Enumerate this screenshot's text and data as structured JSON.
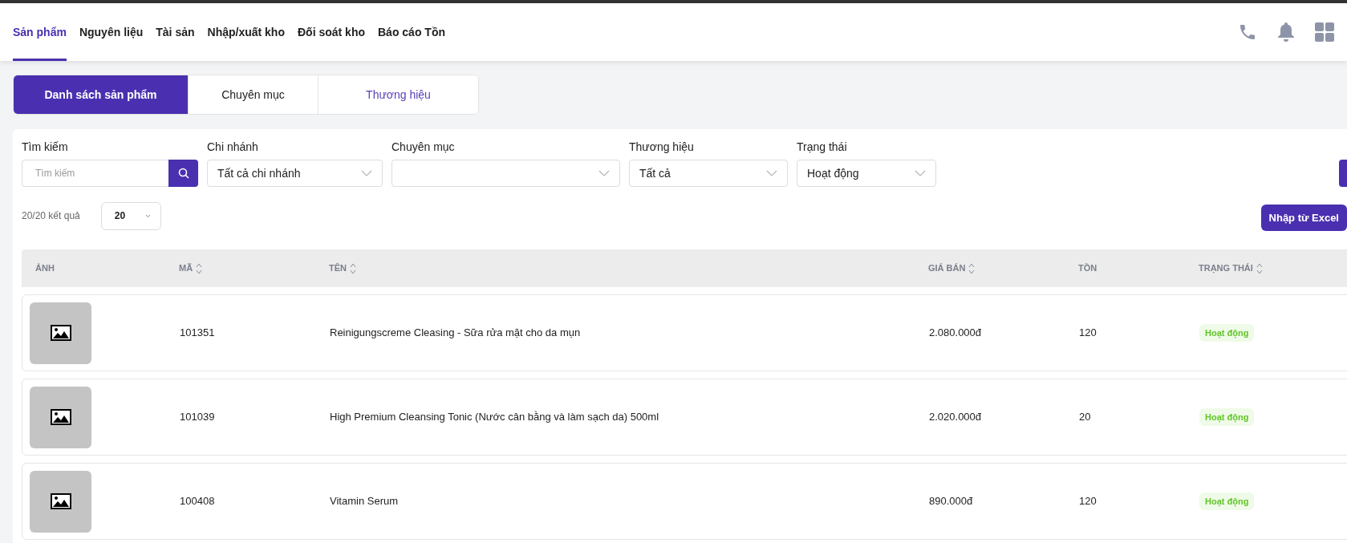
{
  "nav": {
    "tabs": [
      {
        "label": "Sản phẩm",
        "selected": true
      },
      {
        "label": "Nguyên liệu",
        "selected": false
      },
      {
        "label": "Tài sản",
        "selected": false
      },
      {
        "label": "Nhập/xuất kho",
        "selected": false
      },
      {
        "label": "Đối soát kho",
        "selected": false
      },
      {
        "label": "Báo cáo Tồn",
        "selected": false
      }
    ]
  },
  "subtabs": [
    {
      "label": "Danh sách sản phẩm",
      "selected": true
    },
    {
      "label": "Chuyên mục",
      "selected": false
    },
    {
      "label": "Thương hiệu",
      "selected": false
    }
  ],
  "filters": {
    "search": {
      "label": "Tìm kiếm",
      "placeholder": "Tìm kiếm"
    },
    "selects": [
      {
        "label": "Chi nhánh",
        "value": "Tất cả chi nhánh"
      },
      {
        "label": "Chuyên mục"
      },
      {
        "label": "Thương hiệu",
        "value": "Tất cả"
      },
      {
        "label": "Trạng thái",
        "value": "Hoạt động"
      }
    ]
  },
  "results": {
    "count": "20/20 kết quả",
    "page_size": "20"
  },
  "import_button": "Nhập từ Excel",
  "table": {
    "columns": [
      {
        "label": "ẢNH",
        "sortable": false
      },
      {
        "label": "MÃ",
        "sortable": true
      },
      {
        "label": "TÊN",
        "sortable": true
      },
      {
        "label": "GIÁ BÁN",
        "sortable": true
      },
      {
        "label": "TỒN",
        "sortable": false
      },
      {
        "label": "TRẠNG THÁI",
        "sortable": true
      }
    ],
    "rows": [
      {
        "code": "101351",
        "name": "Reinigungscreme Cleasing - Sữa rửa mặt cho da mụn",
        "price": "2.080.000đ",
        "stock": "120",
        "status": "Hoạt động",
        "active": true
      },
      {
        "code": "101039",
        "name": "High Premium Cleansing Tonic (Nước cân bằng và làm sạch da) 500ml",
        "price": "2.020.000đ",
        "stock": "20",
        "status": "Hoạt động",
        "active": true
      },
      {
        "code": "100408",
        "name": "Vitamin Serum",
        "price": "890.000đ",
        "stock": "120",
        "status": "Hoạt động",
        "active": true
      }
    ]
  }
}
